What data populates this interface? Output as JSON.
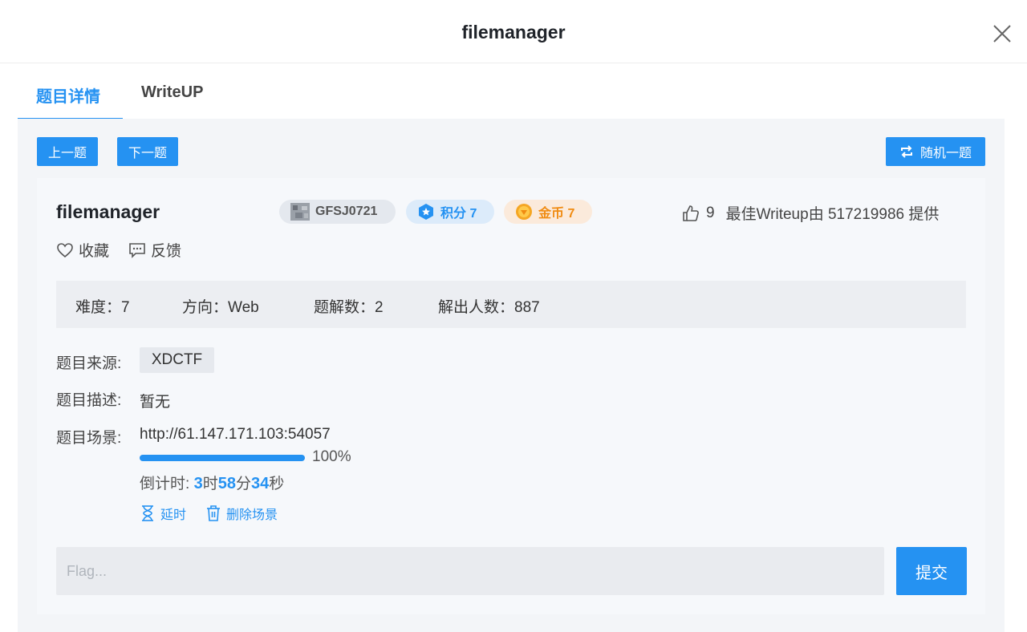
{
  "modal": {
    "title": "filemanager"
  },
  "tabs": [
    {
      "label": "题目详情"
    },
    {
      "label": "WriteUP"
    }
  ],
  "nav": {
    "prev_label": "上一题",
    "next_label": "下一题",
    "random_label": "随机一题"
  },
  "challenge": {
    "name": "filemanager",
    "id_badge": "GFSJ0721",
    "score_badge": "积分 7",
    "coin_badge": "金币 7",
    "likes": "9",
    "best_writeup": "最佳Writeup由 517219986 提供",
    "favorite_label": "收藏",
    "feedback_label": "反馈"
  },
  "stats": {
    "difficulty": "难度：7",
    "direction": "方向：Web",
    "solutions": "题解数：2",
    "solvers": "解出人数：887"
  },
  "details": {
    "source_label": "题目来源:",
    "source_value": "XDCTF",
    "description_label": "题目描述:",
    "description_value": "暂无",
    "scene_label": "题目场景:",
    "scene_url": "http://61.147.171.103:54057",
    "progress_text": "100%",
    "progress_value": 1.0,
    "countdown_prefix": "倒计时: ",
    "countdown_hours": "3",
    "countdown_hours_unit": "时",
    "countdown_minutes": "58",
    "countdown_minutes_unit": "分",
    "countdown_seconds": "34",
    "countdown_seconds_unit": "秒",
    "extend_label": "延时",
    "delete_label": "删除场景"
  },
  "flag": {
    "placeholder": "Flag...",
    "submit_label": "提交"
  },
  "colors": {
    "accent": "#2592f2",
    "coin": "#f08b12"
  }
}
